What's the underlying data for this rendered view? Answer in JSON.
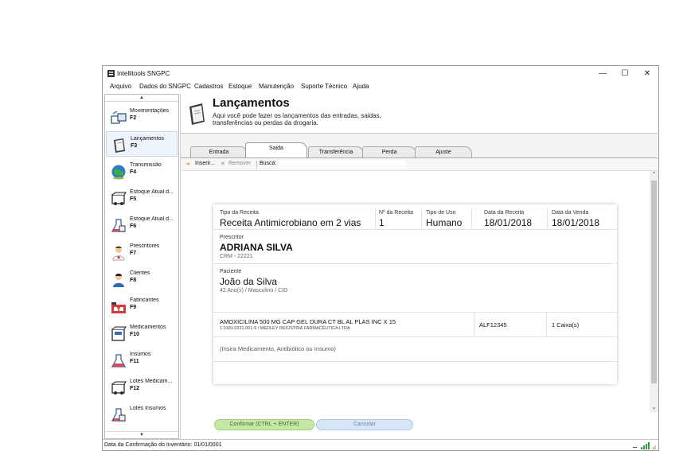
{
  "window": {
    "title": "Intellitools SNGPC"
  },
  "menu": [
    "Arquivo",
    "Dados do SNGPC",
    "Cadastros",
    "Estoque",
    "Manutenção",
    "Suporte Técnico",
    "Ajuda"
  ],
  "sidebar": {
    "items": [
      {
        "label": "Movimentações",
        "key": "F2",
        "icon": "boxes-icon"
      },
      {
        "label": "Lançamentos",
        "key": "F3",
        "icon": "book-icon",
        "active": true
      },
      {
        "label": "Transmissão",
        "key": "F4",
        "icon": "globe-icon"
      },
      {
        "label": "Estoque Atual d...",
        "key": "F5",
        "icon": "box-icon"
      },
      {
        "label": "Estoque Atual d...",
        "key": "F6",
        "icon": "flask-icon"
      },
      {
        "label": "Prescritores",
        "key": "F7",
        "icon": "doctor-icon"
      },
      {
        "label": "Clientes",
        "key": "F8",
        "icon": "user-icon"
      },
      {
        "label": "Fabricantes",
        "key": "F9",
        "icon": "factory-icon"
      },
      {
        "label": "Medicamentos",
        "key": "F10",
        "icon": "medicine-box-icon"
      },
      {
        "label": "Insumos",
        "key": "F11",
        "icon": "flask-icon"
      },
      {
        "label": "Lotes Medicam...",
        "key": "F12",
        "icon": "box-icon"
      },
      {
        "label": "Lotes Insumos",
        "key": "",
        "icon": "flask-icon"
      }
    ]
  },
  "header": {
    "title": "Lançamentos",
    "description": "Aqui você pode fazer os lançamentos das entradas, saidas, transferências ou perdas da drogaria."
  },
  "tabs": [
    "Entrada",
    "Saida",
    "Transferência",
    "Perda",
    "Ajuste"
  ],
  "active_tab": "Saida",
  "toolbar": {
    "insert": "Inserir...",
    "remove": "Remover",
    "search_label": "Busca:",
    "search_value": ""
  },
  "receita": {
    "tipo_label": "Tipo da Receita",
    "tipo_value": "Receita Antimicrobiano em 2 vias",
    "numero_label": "Nº da Receita",
    "numero_value": "1",
    "uso_label": "Tipo de Uso",
    "uso_value": "Humano",
    "data_receita_label": "Data da Receita",
    "data_receita_value": "18/01/2018",
    "data_venda_label": "Data da Venda",
    "data_venda_value": "18/01/2018"
  },
  "prescritor": {
    "label": "Prescritor",
    "name": "ADRIANA SILVA",
    "crm": "CRM - 22221"
  },
  "paciente": {
    "label": "Paciente",
    "name": "João da Silva",
    "info": "42 Ano(s) / Masculino / CID"
  },
  "medicamento": {
    "name": "AMOXICILINA 500 MG CAP GEL DURA CT BL AL PLAS INC X 15",
    "details": "1.0181.0331.001-9 / MEDLEY INDÚSTRIA FARMACÊUTICA LTDA",
    "lote": "ALF12345",
    "quantidade": "1 Caixa(s)"
  },
  "add_hint": "(Insira Medicamento, Antibiótico ou Insumo)",
  "buttons": {
    "confirm": "Confirmar (CTRL + ENTER)",
    "cancel": "Cancelar"
  },
  "status": {
    "text": "Data da Confirmação do Inventário: 01/01/0001"
  },
  "colors": {
    "confirm_bg": "#c5e8a8",
    "cancel_bg": "#d6e6f6",
    "active_sidebar": "#eef4fb"
  }
}
